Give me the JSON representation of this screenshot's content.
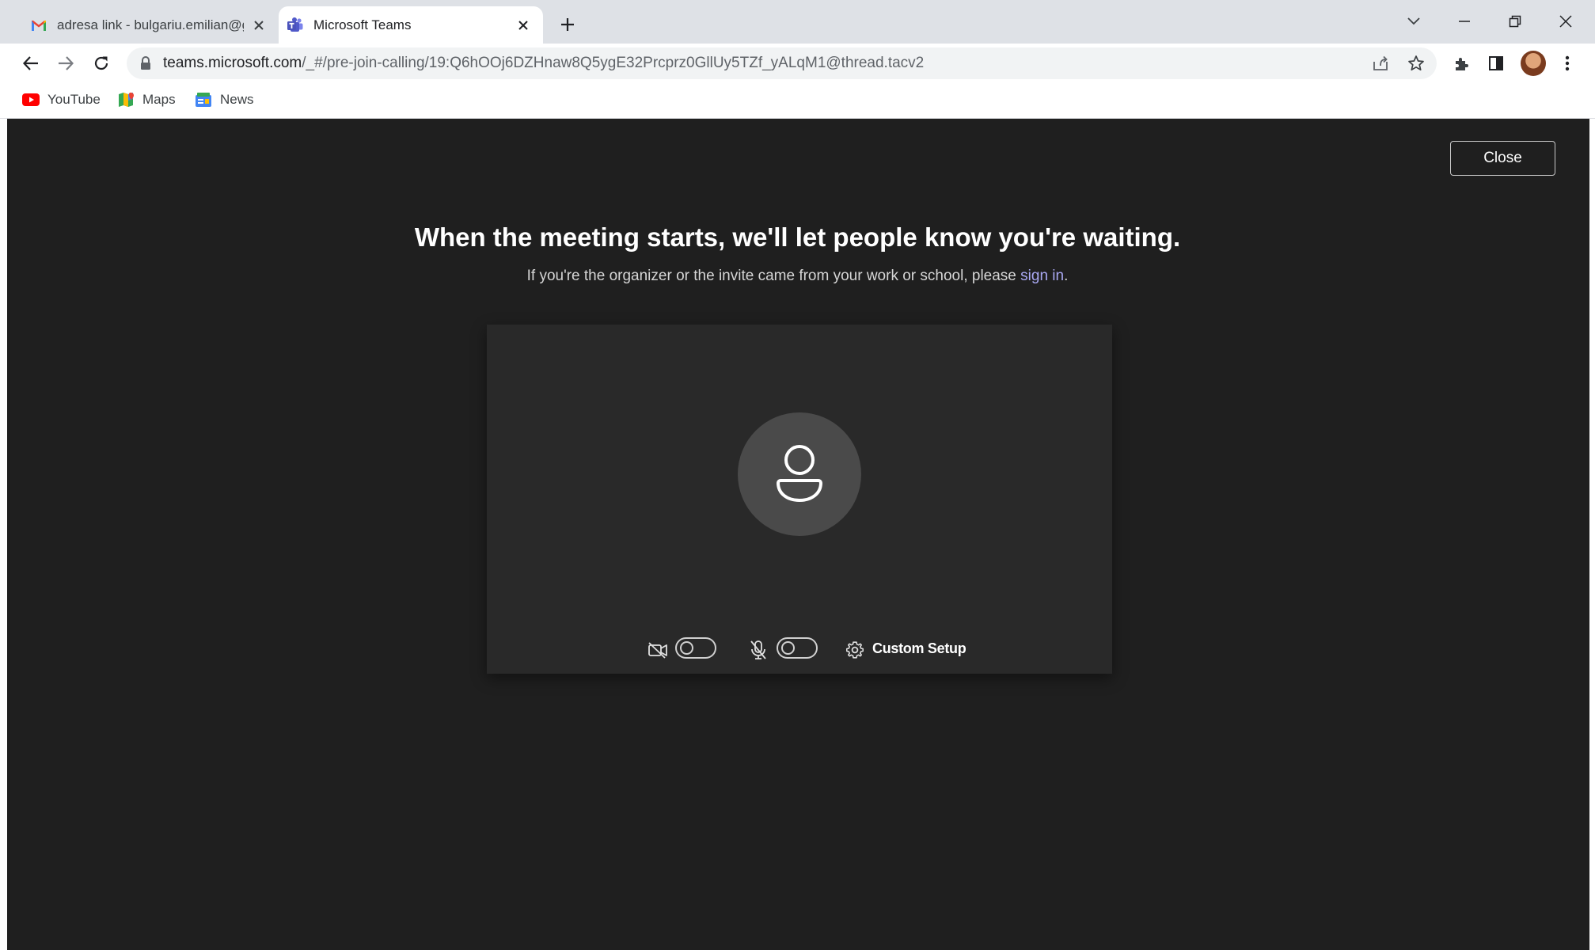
{
  "browser": {
    "tabs": [
      {
        "title": "adresa link - bulgariu.emilian@gmail.com",
        "favicon": "gmail-icon",
        "active": false
      },
      {
        "title": "Microsoft Teams",
        "favicon": "teams-icon",
        "active": true
      }
    ],
    "address_bar": {
      "host": "teams.microsoft.com",
      "path": "/_#/pre-join-calling/19:Q6hOOj6DZHnaw8Q5ygE32Prcprz0GllUy5TZf_yALqM1@thread.tacv2"
    },
    "bookmarks": [
      {
        "label": "YouTube",
        "icon": "youtube-icon"
      },
      {
        "label": "Maps",
        "icon": "maps-icon"
      },
      {
        "label": "News",
        "icon": "news-icon"
      }
    ],
    "colors": {
      "tabstrip": "#dee1e6",
      "omnibox": "#f1f3f4"
    }
  },
  "teams": {
    "close_label": "Close",
    "heading": "When the meeting starts, we'll let people know you're waiting.",
    "subtext_prefix": "If you're the organizer or the invite came from your work or school, please ",
    "sign_in_link": "sign in",
    "subtext_suffix": ".",
    "controls": {
      "camera_on": false,
      "mic_on": false,
      "custom_setup_label": "Custom Setup"
    },
    "colors": {
      "background": "#1f1f1f",
      "preview": "#292929",
      "link": "#a9a8f2"
    }
  }
}
